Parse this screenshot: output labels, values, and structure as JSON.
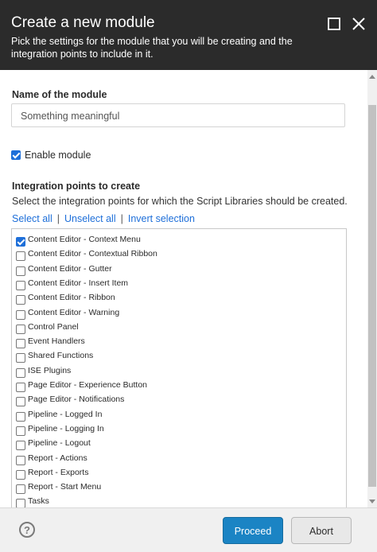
{
  "dialog": {
    "title": "Create a new module",
    "subtitle": "Pick the settings for the module that you will be creating and the integration points to include in it."
  },
  "module": {
    "name_label": "Name of the module",
    "name_placeholder": "Something meaningful",
    "enable_label": "Enable module",
    "enable_checked": true
  },
  "integration": {
    "heading": "Integration points to create",
    "description": "Select the integration points for which the Script Libraries should be created.",
    "select_all": "Select all",
    "unselect_all": "Unselect all",
    "invert_selection": "Invert selection",
    "separator": "|",
    "items": [
      {
        "label": "Content Editor - Context Menu",
        "checked": true
      },
      {
        "label": "Content Editor - Contextual Ribbon",
        "checked": false
      },
      {
        "label": "Content Editor - Gutter",
        "checked": false
      },
      {
        "label": "Content Editor - Insert Item",
        "checked": false
      },
      {
        "label": "Content Editor - Ribbon",
        "checked": false
      },
      {
        "label": "Content Editor - Warning",
        "checked": false
      },
      {
        "label": "Control Panel",
        "checked": false
      },
      {
        "label": "Event Handlers",
        "checked": false
      },
      {
        "label": "Shared Functions",
        "checked": false
      },
      {
        "label": "ISE Plugins",
        "checked": false
      },
      {
        "label": "Page Editor - Experience Button",
        "checked": false
      },
      {
        "label": "Page Editor - Notifications",
        "checked": false
      },
      {
        "label": "Pipeline - Logged In",
        "checked": false
      },
      {
        "label": "Pipeline - Logging In",
        "checked": false
      },
      {
        "label": "Pipeline - Logout",
        "checked": false
      },
      {
        "label": "Report - Actions",
        "checked": false
      },
      {
        "label": "Report - Exports",
        "checked": false
      },
      {
        "label": "Report - Start Menu",
        "checked": false
      },
      {
        "label": "Tasks",
        "checked": false
      }
    ]
  },
  "footer": {
    "help_icon": "?",
    "proceed_label": "Proceed",
    "abort_label": "Abort"
  },
  "colors": {
    "header_bg": "#2b2b2b",
    "accent": "#1e6fd9",
    "proceed_bg": "#1b84c4"
  }
}
